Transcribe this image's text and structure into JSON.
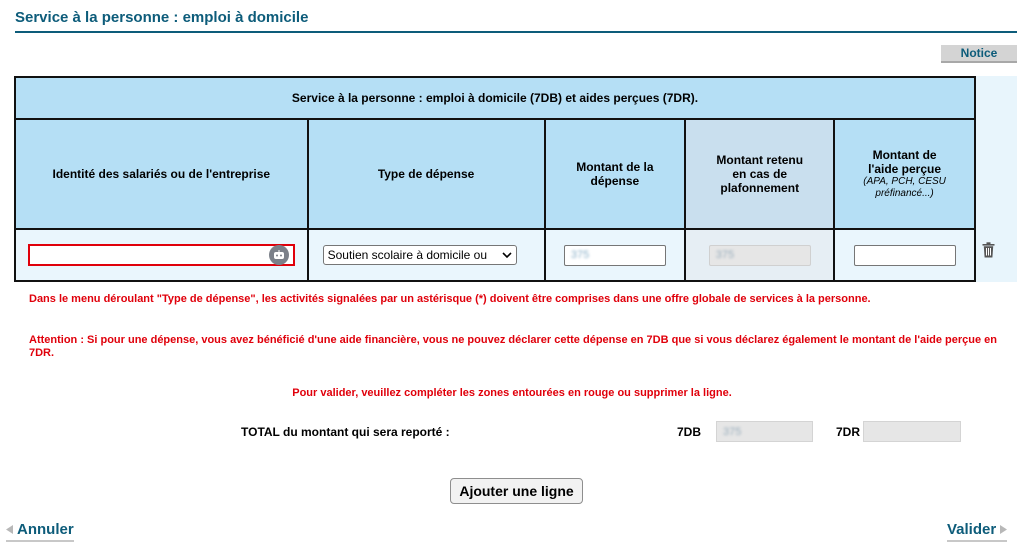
{
  "header": {
    "title": "Service à la personne : emploi à domicile",
    "notice_label": "Notice"
  },
  "grid": {
    "caption": "Service à la personne : emploi à domicile (7DB) et aides perçues (7DR).",
    "columns": {
      "identity": "Identité des salariés ou de l'entreprise",
      "type": "Type de dépense",
      "amount": "Montant de la dépense",
      "capped": "Montant retenu en cas de plafonnement",
      "aid": "Montant de l'aide perçue",
      "aid_note": "(APA, PCH, CESU préfinancé...)"
    },
    "row": {
      "identity_value": "",
      "type_value": "Soutien scolaire à domicile ou",
      "amount_value": "375",
      "capped_value": "375",
      "aid_value": ""
    }
  },
  "messages": {
    "asterisk_note": "Dans le menu déroulant \"Type de dépense\", les activités signalées par un astérisque (*) doivent être comprises dans une offre globale de services à la personne.",
    "attention_note": "Attention : Si pour une dépense, vous avez bénéficié d'une aide financière, vous ne pouvez déclarer cette dépense en 7DB que si vous déclarez également le montant de l'aide perçue en 7DR.",
    "validate_note": "Pour valider, veuillez compléter les zones entourées en rouge ou supprimer la ligne."
  },
  "totals": {
    "label": "TOTAL du montant qui sera reporté :",
    "code_7db": "7DB",
    "value_7db": "375",
    "code_7dr": "7DR",
    "value_7dr": ""
  },
  "actions": {
    "add_line": "Ajouter une ligne",
    "cancel": "Annuler",
    "validate": "Valider"
  },
  "colors": {
    "brand": "#0d5c7a",
    "header_bg": "#b5dff5",
    "error": "#e0000b"
  }
}
